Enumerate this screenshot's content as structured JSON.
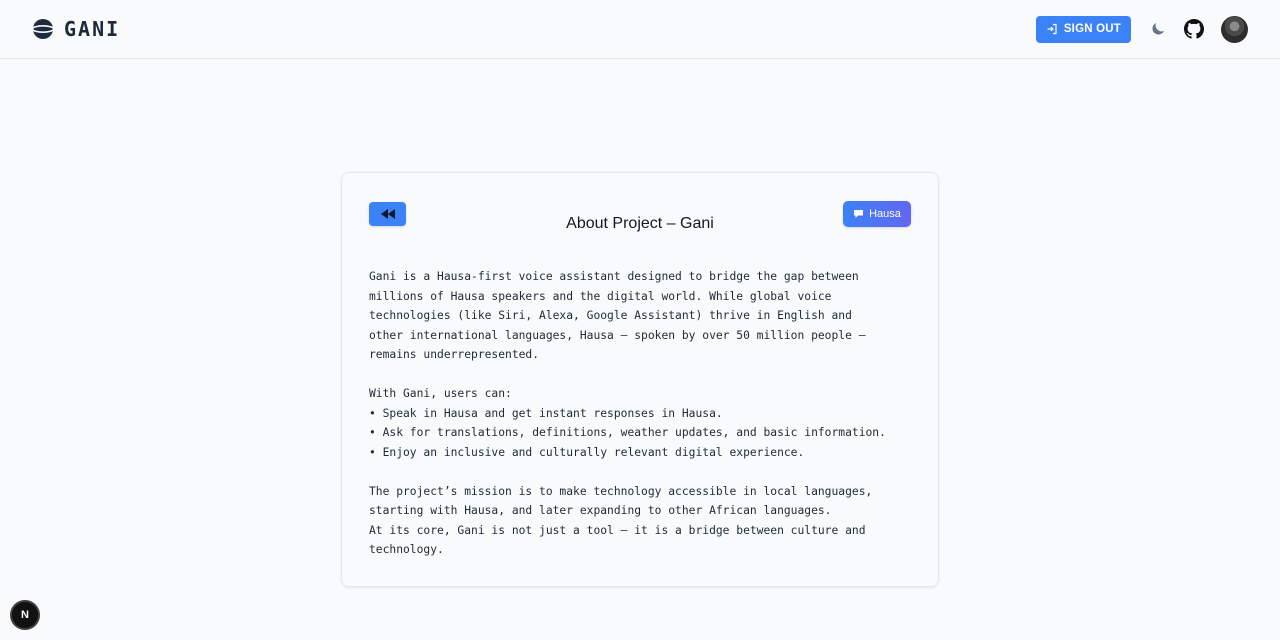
{
  "header": {
    "brand_name": "GANI",
    "signout_label": "SIGN OUT",
    "icons": [
      "logo-icon",
      "sign-in-icon",
      "moon-icon",
      "github-icon",
      "avatar"
    ]
  },
  "card": {
    "title": "About Project – Gani",
    "language_label": "Hausa",
    "paragraphs": [
      "Gani is a Hausa-first voice assistant designed to bridge the gap between\nmillions of Hausa speakers and the digital world. While global voice\ntechnologies (like Siri, Alexa, Google Assistant) thrive in English and\nother international languages, Hausa — spoken by over 50 million people —\nremains underrepresented.",
      "With Gani, users can:\n• Speak in Hausa and get instant responses in Hausa.\n• Ask for translations, definitions, weather updates, and basic information.\n• Enjoy an inclusive and culturally relevant digital experience.",
      "The project’s mission is to make technology accessible in local languages,\nstarting with Hausa, and later expanding to other African languages.\nAt its core, Gani is not just a tool — it is a bridge between culture and\ntechnology."
    ]
  },
  "dev_badge": {
    "label": "N"
  },
  "colors": {
    "accent": "#3b82f6",
    "background": "#f8fafc",
    "border": "#e2e8f0",
    "text": "#0f172a"
  }
}
